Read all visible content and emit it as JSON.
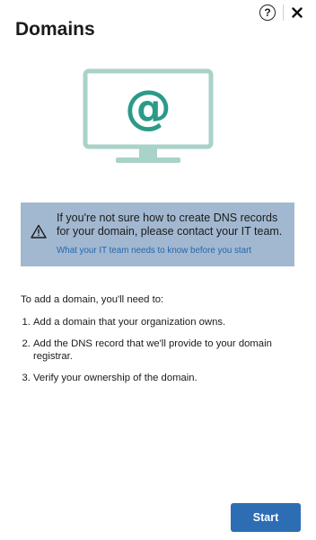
{
  "header": {
    "title": "Domains",
    "help_glyph": "?",
    "help_icon": "help-circle-icon",
    "close_icon": "close-icon"
  },
  "illustration": {
    "glyph": "@",
    "color": "#a9d2c8",
    "icon": "monitor-at-sign-icon"
  },
  "info_box": {
    "message": "If you're not sure how to create DNS records for your domain, please contact your IT team.",
    "link_text": "What your IT team needs to know before you start",
    "icon": "warning-icon",
    "background": "#a2b8d0"
  },
  "instructions": {
    "intro": "To add a domain, you'll need to:",
    "steps": [
      "Add a domain that your organization owns.",
      "Add the DNS record that we'll provide to your domain registrar.",
      "Verify your ownership of the domain."
    ]
  },
  "actions": {
    "start_label": "Start",
    "accent": "#2d6db4"
  }
}
